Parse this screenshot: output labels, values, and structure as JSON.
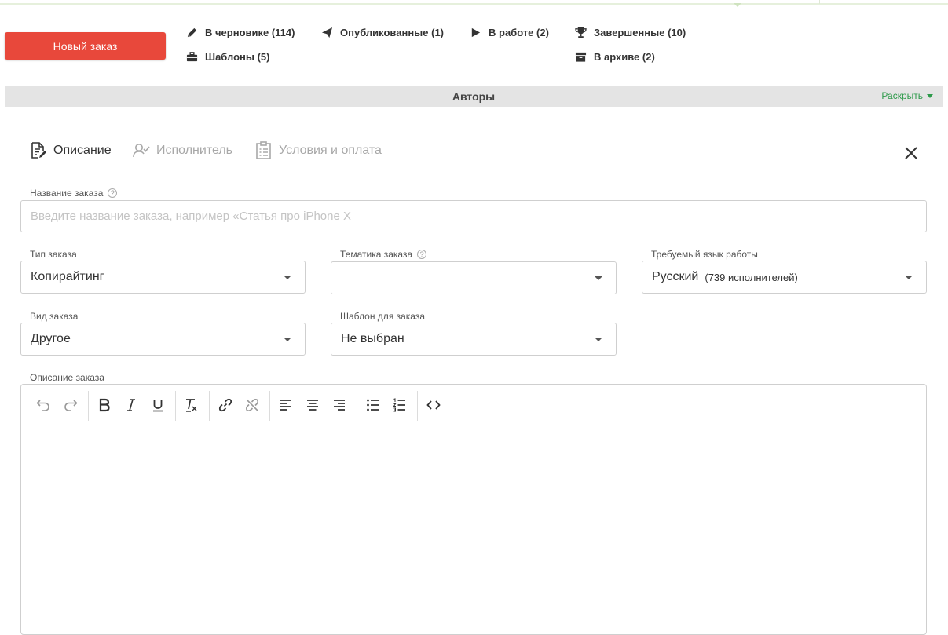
{
  "header": {
    "new_order_label": "Новый заказ",
    "statuses": [
      {
        "label": "В черновике (114)",
        "icon": "pencil-icon"
      },
      {
        "label": "Опубликованные (1)",
        "icon": "paper-plane-icon"
      },
      {
        "label": "В работе (2)",
        "icon": "play-icon"
      },
      {
        "label": "Завершенные (10)",
        "icon": "trophy-icon"
      },
      {
        "label": "Шаблоны (5)",
        "icon": "briefcase-icon"
      },
      {
        "label": "В архиве (2)",
        "icon": "archive-box-icon"
      }
    ]
  },
  "authors_bar": {
    "title": "Авторы",
    "expand_label": "Раскрыть",
    "accent_color": "#2d9a4a"
  },
  "tabs": [
    {
      "label": "Описание",
      "icon": "document-edit-icon",
      "active": true
    },
    {
      "label": "Исполнитель",
      "icon": "user-check-icon",
      "active": false
    },
    {
      "label": "Условия и оплата",
      "icon": "receipt-icon",
      "active": false
    }
  ],
  "form": {
    "order_name": {
      "label": "Название заказа",
      "value": "",
      "placeholder": "Введите название заказа, например «Статья про iPhone X"
    },
    "order_type": {
      "label": "Тип заказа",
      "value": "Копирайтинг"
    },
    "order_topic": {
      "label": "Тематика заказа",
      "value": ""
    },
    "language": {
      "label": "Требуемый язык работы",
      "value": "Русский",
      "sub": "(739 исполнителей)"
    },
    "order_kind": {
      "label": "Вид заказа",
      "value": "Другое"
    },
    "template": {
      "label": "Шаблон для заказа",
      "value": "Не выбран"
    },
    "description": {
      "label": "Описание заказа",
      "value": ""
    }
  },
  "toolbar": [
    {
      "name": "undo-icon"
    },
    {
      "name": "redo-icon"
    },
    {
      "name": "bold-icon"
    },
    {
      "name": "italic-icon"
    },
    {
      "name": "underline-icon"
    },
    {
      "name": "clear-format-icon"
    },
    {
      "name": "link-icon"
    },
    {
      "name": "unlink-icon"
    },
    {
      "name": "align-left-icon"
    },
    {
      "name": "align-center-icon"
    },
    {
      "name": "align-right-icon"
    },
    {
      "name": "bullet-list-icon"
    },
    {
      "name": "numbered-list-icon"
    },
    {
      "name": "code-icon"
    }
  ],
  "colors": {
    "primary_button": "#e8483b",
    "accent_green": "#2d9a4a",
    "bar_gray": "#e4e4e4"
  }
}
